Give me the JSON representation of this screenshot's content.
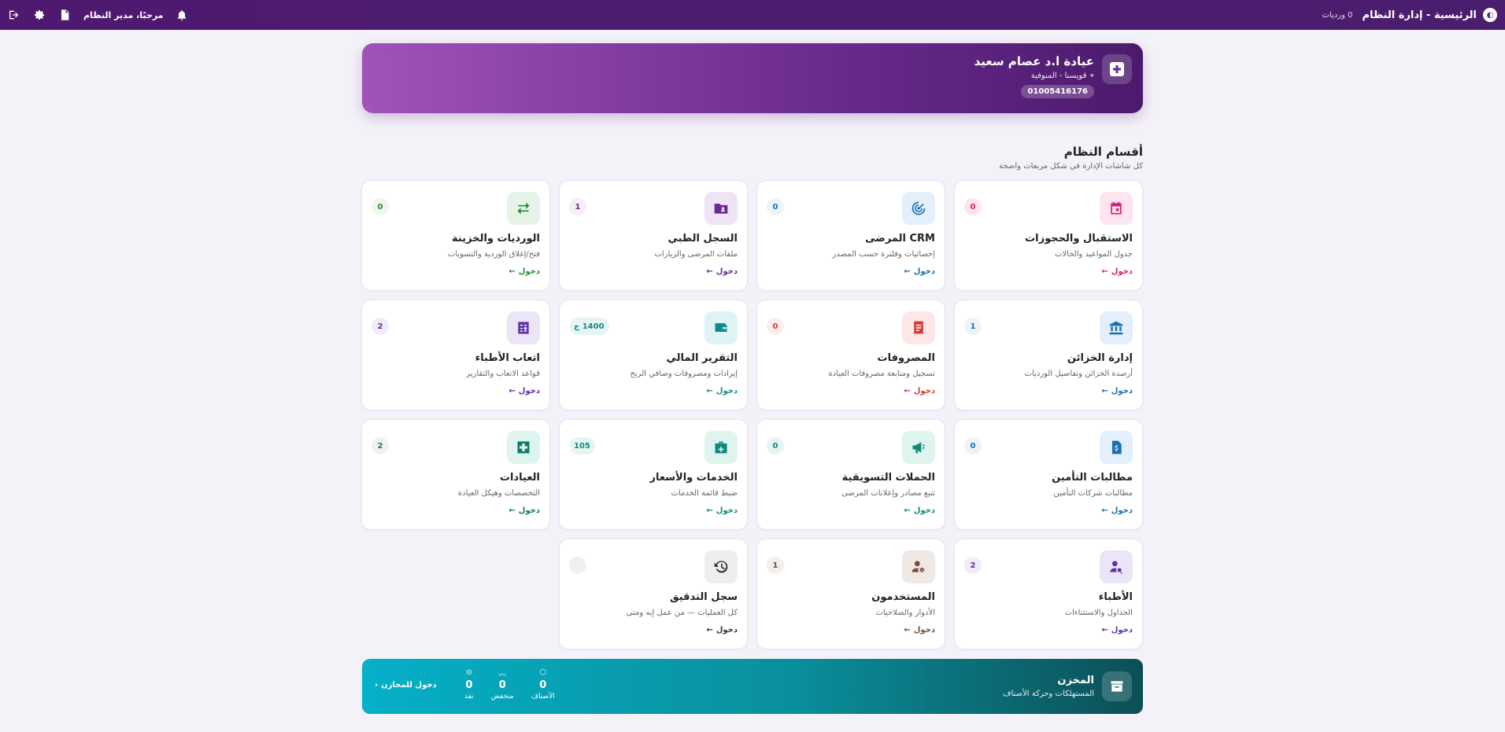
{
  "topbar": {
    "title": "الرئيسية - إدارة النظام",
    "sub": "0 ورديات",
    "greeting": "مرحبًا، مدير النظام"
  },
  "hero": {
    "name": "عيادة ا.د عصام سعيد",
    "location": "قويسنا - المنوفية",
    "phone": "01005416176"
  },
  "section": {
    "title": "أقسام النظام",
    "subtitle": "كل شاشات الإدارة في شكل مربعات واضحة"
  },
  "cards": [
    {
      "id": "reception",
      "title": "الاستقبال والحجوزات",
      "desc": "جدول المواعيد والحالات",
      "badge": "0",
      "link": "دخول",
      "icon": "calendar-icon",
      "color": "#d81b75",
      "bg": "#fde4ef",
      "badge_bg": "#fde4ef"
    },
    {
      "id": "crm",
      "title": "CRM المرضى",
      "desc": "إحصائيات وفلترة حسب المصدر",
      "badge": "0",
      "link": "دخول",
      "icon": "radar-icon",
      "color": "#1a6fb0",
      "bg": "#e3effa",
      "badge_bg": "#eef3f8"
    },
    {
      "id": "records",
      "title": "السجل الطبي",
      "desc": "ملفات المرضى والزيارات",
      "badge": "1",
      "link": "دخول",
      "icon": "folder-user-icon",
      "color": "#6a2a8e",
      "bg": "#efe4f6",
      "badge_bg": "#f3eef7"
    },
    {
      "id": "shifts",
      "title": "الورديات والخزينة",
      "desc": "فتح/إغلاق الوردية والتسويات",
      "badge": "0",
      "link": "دخول",
      "icon": "swap-icon",
      "color": "#2e8b3a",
      "bg": "#e5f4e6",
      "badge_bg": "#eef6ee"
    },
    {
      "id": "treasury",
      "title": "إدارة الخزائن",
      "desc": "أرصدة الخزائن وتفاصيل الورديات",
      "badge": "1",
      "link": "دخول",
      "icon": "bank-icon",
      "color": "#1a6fb0",
      "bg": "#e3effa",
      "badge_bg": "#eef3f8"
    },
    {
      "id": "expenses",
      "title": "المصروفات",
      "desc": "تسجيل ومتابعة مصروفات العيادة",
      "badge": "0",
      "link": "دخول",
      "icon": "receipt-icon",
      "color": "#d33b3b",
      "bg": "#fde6e6",
      "badge_bg": "#fdeeee"
    },
    {
      "id": "financial",
      "title": "التقرير المالي",
      "desc": "إيرادات ومصروفات وصافي الربح",
      "badge": "1400 ج",
      "link": "دخول",
      "icon": "wallet-icon",
      "color": "#0f8a8a",
      "bg": "#def4f3",
      "badge_bg": "#e6f5f4"
    },
    {
      "id": "doctor_fees",
      "title": "اتعاب الأطباء",
      "desc": "قواعد الاتعاب والتقارير",
      "badge": "2",
      "link": "دخول",
      "icon": "calculator-icon",
      "color": "#5b2fa8",
      "bg": "#ece4f7",
      "badge_bg": "#f1ecf8"
    },
    {
      "id": "insurance",
      "title": "مطالبات التأمين",
      "desc": "مطالبات شركات التأمين",
      "badge": "0",
      "link": "دخول",
      "icon": "dollar-doc-icon",
      "color": "#1a6fb0",
      "bg": "#e3effa",
      "badge_bg": "#eef3f8"
    },
    {
      "id": "campaigns",
      "title": "الحملات التسويقية",
      "desc": "تتبع مصادر وإعلانات المرضى",
      "badge": "0",
      "link": "دخول",
      "icon": "megaphone-icon",
      "color": "#0f8a7a",
      "bg": "#def4ef",
      "badge_bg": "#e8f4f1"
    },
    {
      "id": "services",
      "title": "الخدمات والأسعار",
      "desc": "ضبط قائمة الخدمات",
      "badge": "105",
      "link": "دخول",
      "icon": "medkit-icon",
      "color": "#0f8a7a",
      "bg": "#def4ef",
      "badge_bg": "#e6f5f1"
    },
    {
      "id": "clinics",
      "title": "العيادات",
      "desc": "التخصصات وهيكل العيادة",
      "badge": "2",
      "link": "دخول",
      "icon": "hospital-cross-icon",
      "color": "#0f7a6a",
      "bg": "#def4ef",
      "badge_bg": "#eef3f1"
    },
    {
      "id": "doctors",
      "title": "الأطباء",
      "desc": "الجداول والاستثناءات",
      "badge": "2",
      "link": "دخول",
      "icon": "doctor-search-icon",
      "color": "#5b2fa8",
      "bg": "#ece4f7",
      "badge_bg": "#f1ecf8"
    },
    {
      "id": "users",
      "title": "المستخدمون",
      "desc": "الأدوار والصلاحيات",
      "badge": "1",
      "link": "دخول",
      "icon": "user-gear-icon",
      "color": "#7a4a3a",
      "bg": "#efe8e4",
      "badge_bg": "#f3efec"
    },
    {
      "id": "audit",
      "title": "سجل التدقيق",
      "desc": "كل العمليات — من عمل إيه ومتى",
      "badge": "",
      "link": "دخول",
      "icon": "history-icon",
      "color": "#333333",
      "bg": "#eeeeee",
      "badge_bg": "#f0f0f0"
    }
  ],
  "store": {
    "title": "المخزن",
    "subtitle": "المستهلكات وحركة الأصناف",
    "stats": [
      {
        "label": "الأصناف",
        "value": "0",
        "icon": "boxes-icon"
      },
      {
        "label": "منخفض",
        "value": "0",
        "icon": "trend-down-icon"
      },
      {
        "label": "نفد",
        "value": "0",
        "icon": "minus-circle-icon"
      }
    ],
    "link": "دخول للمخازن"
  }
}
